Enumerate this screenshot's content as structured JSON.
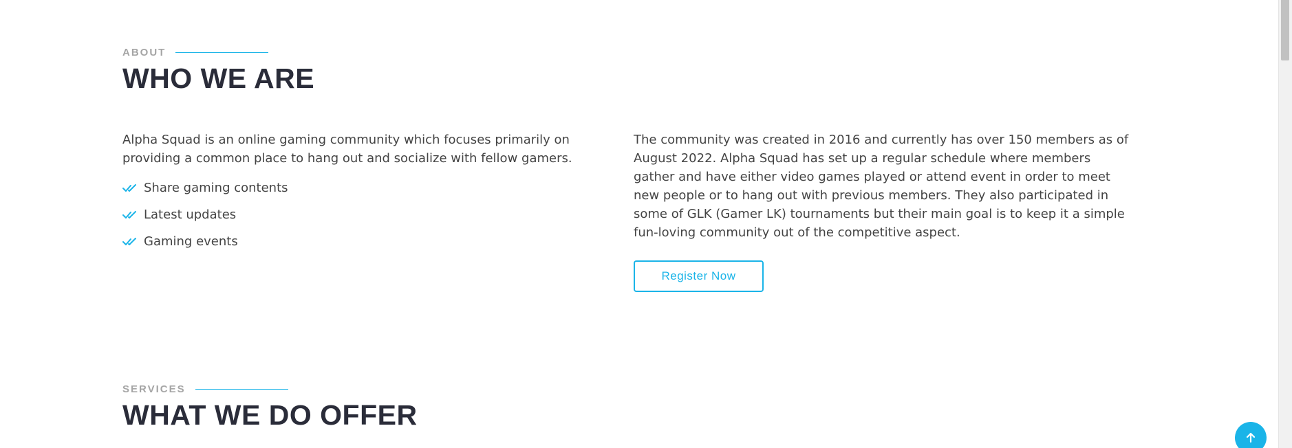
{
  "about": {
    "kicker": "ABOUT",
    "heading": "WHO WE ARE",
    "intro": "Alpha Squad is an online gaming community which focuses primarily on providing a common place to hang out and socialize with fellow gamers.",
    "features": [
      {
        "label": "Share gaming contents",
        "icon": "double-check-icon"
      },
      {
        "label": "Latest updates",
        "icon": "double-check-icon"
      },
      {
        "label": "Gaming events",
        "icon": "double-check-icon"
      }
    ],
    "description": "The community was created in 2016 and currently has over 150 members as of August 2022. Alpha Squad has set up a regular schedule where members gather and have either video games played or attend event in order to meet new people or to hang out with previous members. They also participated in some of GLK (Gamer LK) tournaments but their main goal is to keep it a simple fun-loving community out of the competitive aspect.",
    "register_button": "Register Now"
  },
  "services": {
    "kicker": "SERVICES",
    "heading": "WHAT WE DO OFFER"
  },
  "back_to_top": {
    "icon": "arrow-up-icon"
  },
  "colors": {
    "accent": "#1ab4e8",
    "heading": "#2a2c39",
    "text": "#444444",
    "kicker": "#a5a5a5"
  }
}
